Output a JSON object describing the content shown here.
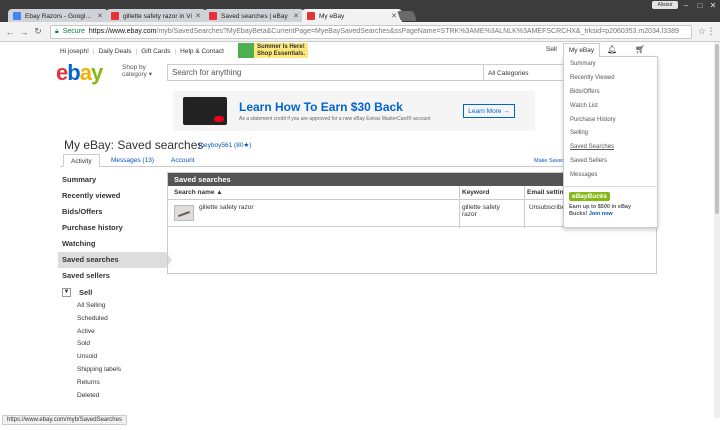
{
  "browser": {
    "user_label": "Alistair",
    "tabs": [
      {
        "title": "Ebay Razors - Google Do",
        "icon_color": "#4285f4",
        "active": false
      },
      {
        "title": "gillette safety razor in Vi",
        "icon_color": "#e53238",
        "active": false
      },
      {
        "title": "Saved searches | eBay",
        "icon_color": "#e53238",
        "active": false
      },
      {
        "title": "My eBay",
        "icon_color": "#e53238",
        "active": true
      }
    ],
    "secure_label": "Secure",
    "url_host": "https://www.ebay.com",
    "url_rest": "/myb/SavedSearches?MyEbayBeta&CurrentPage=MyeBaySavedSearches&ssPageName=STRK%3AME%3ALNLK%3AMEFSCRCHX&_trksid=p2060353.m2034.l3389"
  },
  "utility": {
    "greeting": "Hi joseph!",
    "daily_deals": "Daily Deals",
    "gift_cards": "Gift Cards",
    "help": "Help & Contact",
    "promo_line1": "Summer Is Here!",
    "promo_line2": "Shop Essentials.",
    "sell": "Sell",
    "my_ebay": "My eBay"
  },
  "header": {
    "logo": [
      "e",
      "b",
      "a",
      "y"
    ],
    "shop_by": "Shop by category",
    "search_placeholder": "Search for anything",
    "category": "All Categories"
  },
  "banner": {
    "headline": "Learn How To Earn $30 Back",
    "sub": "As a statement credit if you are approved for a new eBay Extras MasterCard® account",
    "button": "Learn More →"
  },
  "page": {
    "title": "My eBay: Saved searches",
    "username": "joeyboy561 (80★)",
    "tabs": [
      "Activity",
      "Messages (13)",
      "Account"
    ],
    "make_saved": "Make Saved"
  },
  "sidebar": {
    "items": [
      "Summary",
      "Recently viewed",
      "Bids/Offers",
      "Purchase history",
      "Watching",
      "Saved searches",
      "Saved sellers"
    ],
    "sell_label": "Sell",
    "sell_items": [
      "All Selling",
      "Scheduled",
      "Active",
      "Sold",
      "Unsold",
      "Shipping labels",
      "Returns",
      "Deleted"
    ]
  },
  "panel": {
    "title": "Saved searches",
    "col_name": "Search name ▲",
    "col_keyword": "Keyword",
    "col_email": "Email settings",
    "rows": [
      {
        "name": "gillette safety razor",
        "keyword": "gillette safety razor",
        "email": "Unsubscribe"
      }
    ]
  },
  "dropdown": {
    "items": [
      "Summary",
      "Recently Viewed",
      "Bids/Offers",
      "Watch List",
      "Purchase History",
      "Selling",
      "Saved Searches",
      "Saved Sellers",
      "Messages"
    ],
    "bucks_logo": "eBayBucks",
    "bucks_text": "Earn up to $500 in eBay Bucks!",
    "bucks_link": "Join now"
  },
  "status_url": "https://www.ebay.com/myb/SavedSearches"
}
